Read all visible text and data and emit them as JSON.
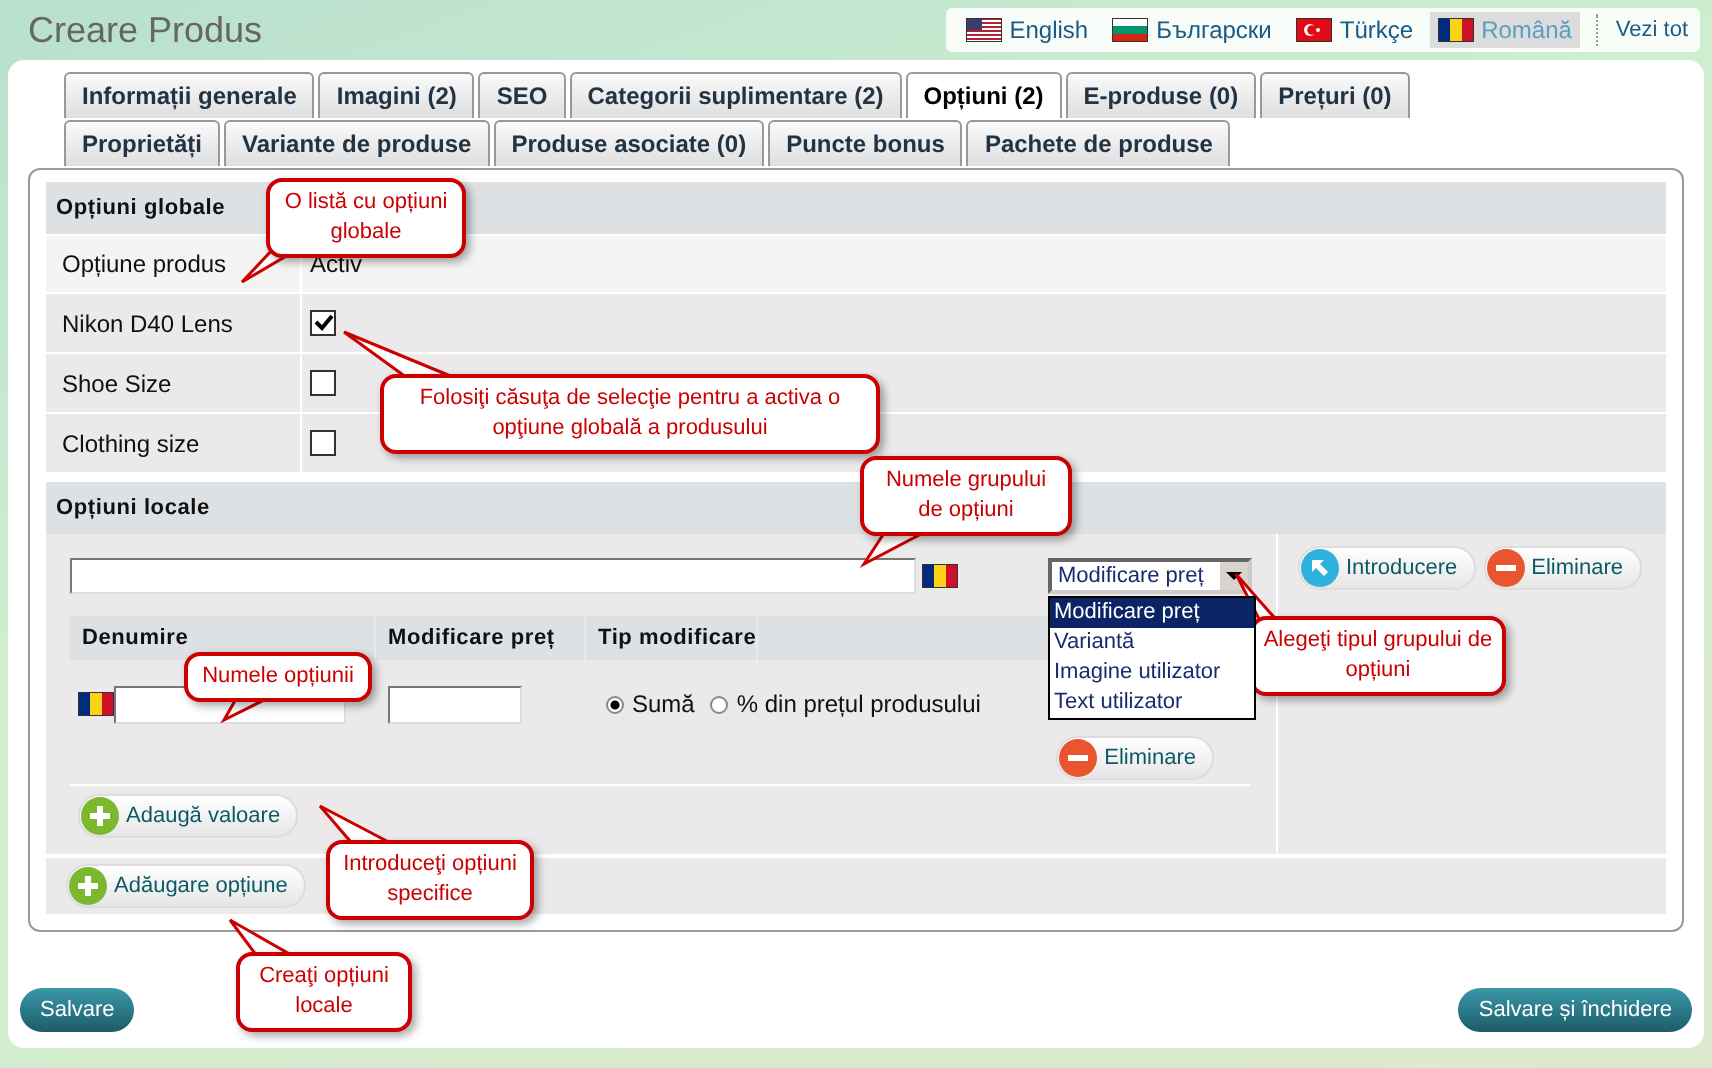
{
  "header": {
    "title": "Creare Produs",
    "languages": [
      {
        "label": "English",
        "kind": "us",
        "selected": false
      },
      {
        "label": "Български",
        "kind": "bg",
        "selected": false
      },
      {
        "label": "Türkçe",
        "kind": "tr",
        "selected": false
      },
      {
        "label": "Română",
        "kind": "ro",
        "selected": true
      }
    ],
    "view_all": "Vezi tot"
  },
  "tab_rows": [
    {
      "tabs": [
        {
          "label": "Informații generale",
          "selected": false
        },
        {
          "label": "Imagini (2)",
          "selected": false
        },
        {
          "label": "SEO",
          "selected": false
        },
        {
          "label": "Categorii suplimentare (2)",
          "selected": false
        },
        {
          "label": "Opțiuni (2)",
          "selected": true
        },
        {
          "label": "E-produse (0)",
          "selected": false
        },
        {
          "label": "Prețuri (0)",
          "selected": false
        }
      ]
    },
    {
      "tabs": [
        {
          "label": "Proprietăți",
          "selected": false
        },
        {
          "label": "Variante de produse",
          "selected": false
        },
        {
          "label": "Produse asociate (0)",
          "selected": false
        },
        {
          "label": "Puncte bonus",
          "selected": false
        },
        {
          "label": "Pachete de produse",
          "selected": false
        }
      ]
    }
  ],
  "global_options": {
    "heading": "Opțiuni globale",
    "header_row": {
      "label": "Opțiune produs",
      "value": "Activ"
    },
    "rows": [
      {
        "label": "Nikon D40 Lens",
        "checked": true
      },
      {
        "label": "Shoe Size",
        "checked": false
      },
      {
        "label": "Clothing size",
        "checked": false
      }
    ]
  },
  "local_options": {
    "heading": "Opțiuni locale",
    "type_select": {
      "value": "Modificare preț",
      "expanded": true,
      "options": [
        {
          "label": "Modificare preț",
          "selected": true
        },
        {
          "label": "Variantă",
          "selected": false
        },
        {
          "label": "Imagine utilizator",
          "selected": false
        },
        {
          "label": "Text utilizator",
          "selected": false
        }
      ]
    },
    "columns": [
      "Denumire",
      "Modificare preț",
      "Tip modificare"
    ],
    "modes": [
      {
        "label": "Sumă",
        "selected": true
      },
      {
        "label": "% din prețul produsului",
        "selected": false
      }
    ],
    "remove_value_button": "Eliminare",
    "add_value_button": "Adaugă valoare",
    "insert_button": "Introducere",
    "remove_group_button": "Eliminare",
    "add_option_button": "Adăugare opțiune"
  },
  "buttons": {
    "save": "Salvare",
    "save_close": "Salvare și închidere"
  },
  "callouts": [
    {
      "text": "O listă cu opțiuni globale"
    },
    {
      "text": "Folosiţi căsuţa de selecţie pentru a activa o opţiune globală a produsului"
    },
    {
      "text": "Numele grupului de opțiuni"
    },
    {
      "text": "Numele opțiunii"
    },
    {
      "text": "Alegeţi tipul grupului de opțiuni"
    },
    {
      "text": "Introduceţi opțiuni specifice"
    },
    {
      "text": "Creaţi opțiuni locale"
    }
  ]
}
